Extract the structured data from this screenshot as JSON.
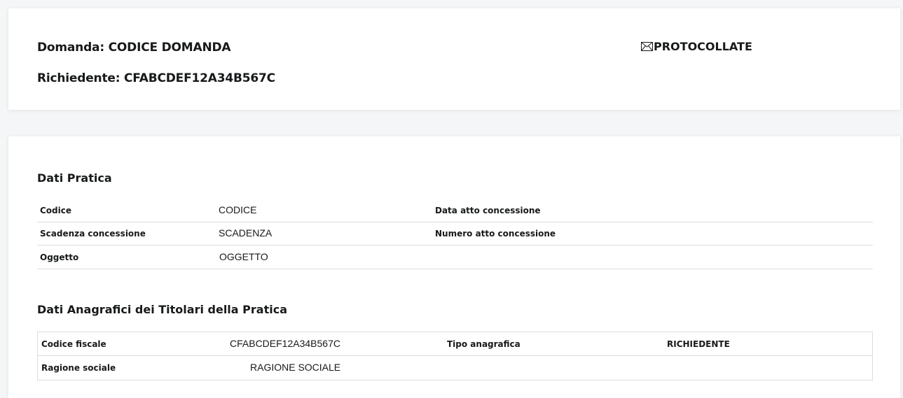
{
  "header": {
    "domanda_label": "Domanda:",
    "domanda_value": "CODICE DOMANDA",
    "richiedente_label": "Richiedente:",
    "richiedente_value": "CFABCDEF12A34B567C",
    "status": {
      "icon": "envelope-icon",
      "label": "PROTOCOLLATE"
    }
  },
  "dati_pratica": {
    "title": "Dati Pratica",
    "rows": [
      {
        "label1": "Codice",
        "value1": "CODICE",
        "label2": "Data atto concessione",
        "value2": ""
      },
      {
        "label1": "Scadenza concessione",
        "value1": "SCADENZA",
        "label2": "Numero atto concessione",
        "value2": ""
      },
      {
        "label1": "Oggetto",
        "value1": "OGGETTO",
        "label2": "",
        "value2": ""
      }
    ]
  },
  "dati_anagrafici": {
    "title": "Dati Anagrafici dei Titolari della Pratica",
    "rows": [
      {
        "label1": "Codice fiscale",
        "value1": "CFABCDEF12A34B567C",
        "label2": "Tipo anagrafica",
        "value2": "RICHIEDENTE"
      },
      {
        "label1": "Ragione sociale",
        "value1": "RAGIONE SOCIALE",
        "label2": "",
        "value2": ""
      }
    ]
  }
}
